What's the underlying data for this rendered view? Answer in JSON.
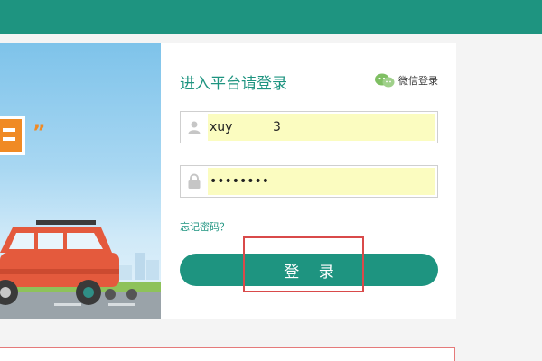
{
  "login": {
    "title": "进入平台请登录",
    "wechat_label": "微信登录",
    "username_value": "xuy          3",
    "password_value": "••••••••",
    "forgot_label": "忘记密码？",
    "submit_label": "登 录"
  },
  "colors": {
    "brand": "#1e9480",
    "input_fill": "#fbfcc0",
    "annotation": "#d94a4a"
  },
  "icons": {
    "wechat": "wechat-icon",
    "user": "user-icon",
    "lock": "lock-icon"
  }
}
